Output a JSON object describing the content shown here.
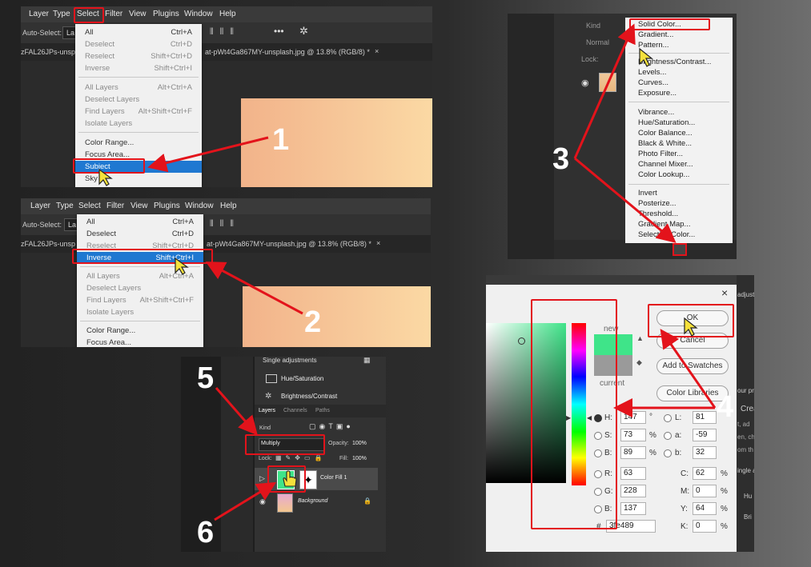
{
  "numbers": [
    "1",
    "2",
    "3",
    "4",
    "5",
    "6"
  ],
  "menubar": {
    "items": [
      "Layer",
      "Type",
      "Select",
      "Filter",
      "View",
      "Plugins",
      "Window",
      "Help"
    ],
    "auto_select": "Auto-Select:",
    "auto_select_value": "La",
    "tab_prefix": "zFAL26JPs-unsp",
    "tab_title": "at-pWt4Ga867MY-unsplash.jpg @ 13.8% (RGB/8) *",
    "tab_close": "×"
  },
  "select_menu": {
    "items": [
      {
        "label": "All",
        "shortcut": "Ctrl+A"
      },
      {
        "label": "Deselect",
        "shortcut": "Ctrl+D"
      },
      {
        "label": "Reselect",
        "shortcut": "Shift+Ctrl+D"
      },
      {
        "label": "Inverse",
        "shortcut": "Shift+Ctrl+I"
      },
      {
        "label": "All Layers",
        "shortcut": "Alt+Ctrl+A"
      },
      {
        "label": "Deselect Layers",
        "shortcut": ""
      },
      {
        "label": "Find Layers",
        "shortcut": "Alt+Shift+Ctrl+F"
      },
      {
        "label": "Isolate Layers",
        "shortcut": ""
      },
      {
        "label": "Color Range...",
        "shortcut": ""
      },
      {
        "label": "Focus Area...",
        "shortcut": ""
      },
      {
        "label": "Subject",
        "shortcut": ""
      },
      {
        "label": "Sky",
        "shortcut": ""
      }
    ]
  },
  "adjust_menu": {
    "search": "Kind",
    "blend": "Normal",
    "lock": "Lock:",
    "items": [
      "Solid Color...",
      "Gradient...",
      "Pattern...",
      "Brightness/Contrast...",
      "Levels...",
      "Curves...",
      "Exposure...",
      "Vibrance...",
      "Hue/Saturation...",
      "Color Balance...",
      "Black & White...",
      "Photo Filter...",
      "Channel Mixer...",
      "Color Lookup...",
      "Invert",
      "Posterize...",
      "Threshold...",
      "Gradient Map...",
      "Selective Color..."
    ]
  },
  "color_picker": {
    "close": "×",
    "new_label": "new",
    "current_label": "current",
    "buttons": {
      "ok": "OK",
      "cancel": "Cancel",
      "swatches": "Add to Swatches",
      "libraries": "Color Libraries"
    },
    "hsb": [
      {
        "l": "H:",
        "v": "147",
        "u": "°"
      },
      {
        "l": "S:",
        "v": "73",
        "u": "%"
      },
      {
        "l": "B:",
        "v": "89",
        "u": "%"
      }
    ],
    "rgb": [
      {
        "l": "R:",
        "v": "63"
      },
      {
        "l": "G:",
        "v": "228"
      },
      {
        "l": "B:",
        "v": "137"
      }
    ],
    "lab": [
      {
        "l": "L:",
        "v": "81"
      },
      {
        "l": "a:",
        "v": "-59"
      },
      {
        "l": "b:",
        "v": "32"
      }
    ],
    "cmyk": [
      {
        "l": "C:",
        "v": "62",
        "u": "%"
      },
      {
        "l": "M:",
        "v": "0",
        "u": "%"
      },
      {
        "l": "Y:",
        "v": "64",
        "u": "%"
      },
      {
        "l": "K:",
        "v": "0",
        "u": "%"
      }
    ],
    "hex_label": "#",
    "hex": "3fe489",
    "side": [
      "adjustm",
      "our pro",
      "Crea",
      "t, ad",
      "en, cho",
      "om th",
      "ingle a",
      "Hu",
      "Bri"
    ],
    "colors": {
      "new": "#3fe489",
      "current": "#9a9a9a"
    }
  },
  "layers_panel": {
    "header": "Single adjustments",
    "adjustments": [
      "Hue/Saturation",
      "Brightness/Contrast"
    ],
    "tabs": [
      "Layers",
      "Channels",
      "Paths"
    ],
    "kind": "Kind",
    "blend_mode": "Multiply",
    "opacity_label": "Opacity:",
    "opacity": "100%",
    "lock_label": "Lock:",
    "fill_label": "Fill:",
    "fill": "100%",
    "layers": [
      {
        "name": "Color Fill 1"
      },
      {
        "name": "Background"
      }
    ]
  }
}
